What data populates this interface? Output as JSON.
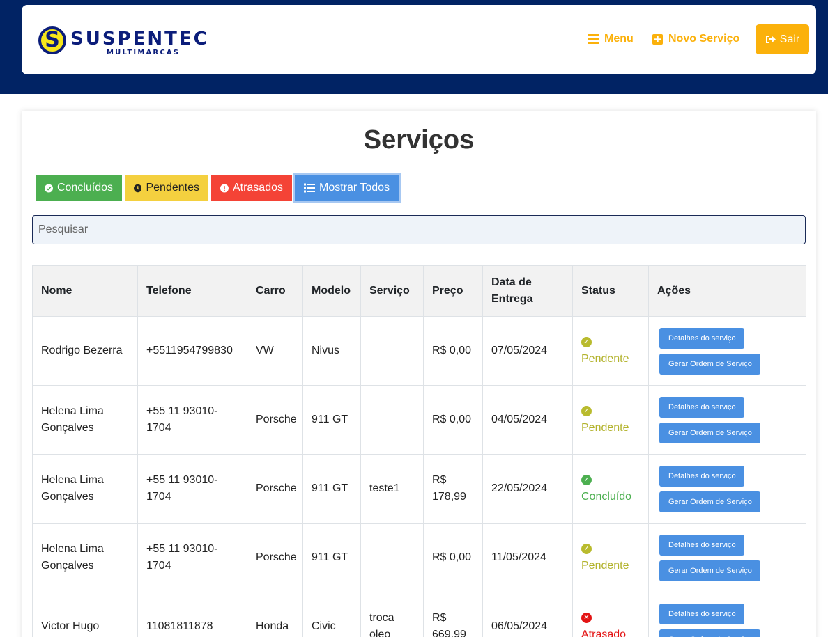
{
  "brand": {
    "logo_letter": "S",
    "name": "SUSPENTEC",
    "sub": "MULTIMARCAS"
  },
  "nav": {
    "menu_label": "Menu",
    "new_service_label": "Novo Serviço",
    "logout_label": "Sair"
  },
  "page": {
    "title": "Serviços"
  },
  "filters": {
    "done": "Concluídos",
    "pending": "Pendentes",
    "late": "Atrasados",
    "all": "Mostrar Todos"
  },
  "search": {
    "placeholder": "Pesquisar"
  },
  "table": {
    "headers": [
      "Nome",
      "Telefone",
      "Carro",
      "Modelo",
      "Serviço",
      "Preço",
      "Data de Entrega",
      "Status",
      "Ações"
    ],
    "rows": [
      {
        "nome": "Rodrigo Bezerra",
        "telefone": "+5511954799830",
        "carro": "VW",
        "modelo": "Nivus",
        "servico": "",
        "preco": "R$ 0,00",
        "data": "07/05/2024",
        "status": "Pendente"
      },
      {
        "nome": "Helena Lima Gonçalves",
        "telefone": "+55 11 93010-1704",
        "carro": "Porsche",
        "modelo": "911 GT",
        "servico": "",
        "preco": "R$ 0,00",
        "data": "04/05/2024",
        "status": "Pendente"
      },
      {
        "nome": "Helena Lima Gonçalves",
        "telefone": "+55 11 93010-1704",
        "carro": "Porsche",
        "modelo": "911 GT",
        "servico": "teste1",
        "preco": "R$ 178,99",
        "data": "22/05/2024",
        "status": "Concluído"
      },
      {
        "nome": "Helena Lima Gonçalves",
        "telefone": "+55 11 93010-1704",
        "carro": "Porsche",
        "modelo": "911 GT",
        "servico": "",
        "preco": "R$ 0,00",
        "data": "11/05/2024",
        "status": "Pendente"
      },
      {
        "nome": "Victor Hugo",
        "telefone": "11081811878",
        "carro": "Honda",
        "modelo": "Civic",
        "servico": "troca oleo",
        "preco": "R$ 669,99",
        "data": "06/05/2024",
        "status": "Atrasado"
      }
    ],
    "action_details": "Detalhes do serviço",
    "action_order": "Gerar Ordem de Serviço"
  },
  "colors": {
    "navy": "#012364",
    "accent": "#fbb10b",
    "done": "#4caf50",
    "pending": "#f4d03f",
    "late": "#f44336",
    "all": "#4a90e2"
  }
}
